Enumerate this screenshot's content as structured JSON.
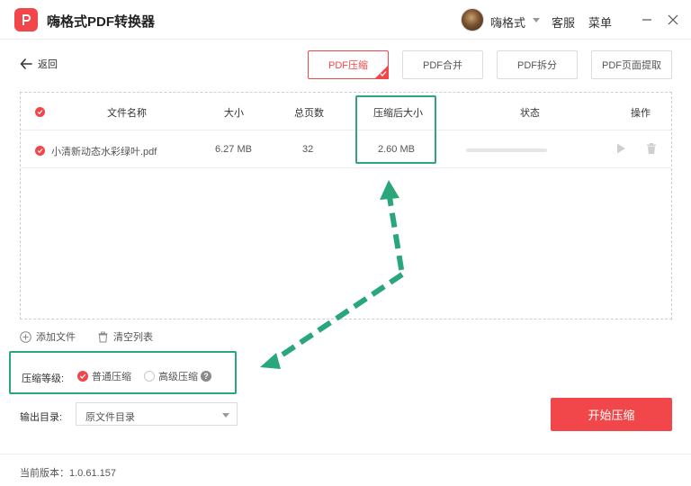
{
  "app": {
    "title": "嗨格式PDF转换器",
    "user_name": "嗨格式",
    "service_label": "客服",
    "menu_label": "菜单"
  },
  "nav": {
    "back_label": "返回"
  },
  "tabs": [
    {
      "label": "PDF压缩",
      "active": true
    },
    {
      "label": "PDF合并",
      "active": false
    },
    {
      "label": "PDF拆分",
      "active": false
    },
    {
      "label": "PDF页面提取",
      "active": false
    }
  ],
  "table": {
    "headers": {
      "name": "文件名称",
      "size": "大小",
      "pages": "总页数",
      "compressed_size": "压缩后大小",
      "status": "状态",
      "actions": "操作"
    },
    "rows": [
      {
        "name": "小清新动态水彩绿叶.pdf",
        "size": "6.27 MB",
        "pages": "32",
        "compressed_size": "2.60 MB",
        "progress": 0
      }
    ]
  },
  "actions": {
    "add_file": "添加文件",
    "clear_list": "清空列表"
  },
  "compression": {
    "label": "压缩等级:",
    "options": [
      {
        "label": "普通压缩",
        "selected": true
      },
      {
        "label": "高级压缩",
        "selected": false
      }
    ],
    "help": "?"
  },
  "output": {
    "label": "输出目录:",
    "selected": "原文件目录"
  },
  "start_button": "开始压缩",
  "footer": {
    "version": "当前版本：1.0.61.157"
  },
  "colors": {
    "accent": "#f2474a",
    "annotation": "#2aa77a"
  }
}
